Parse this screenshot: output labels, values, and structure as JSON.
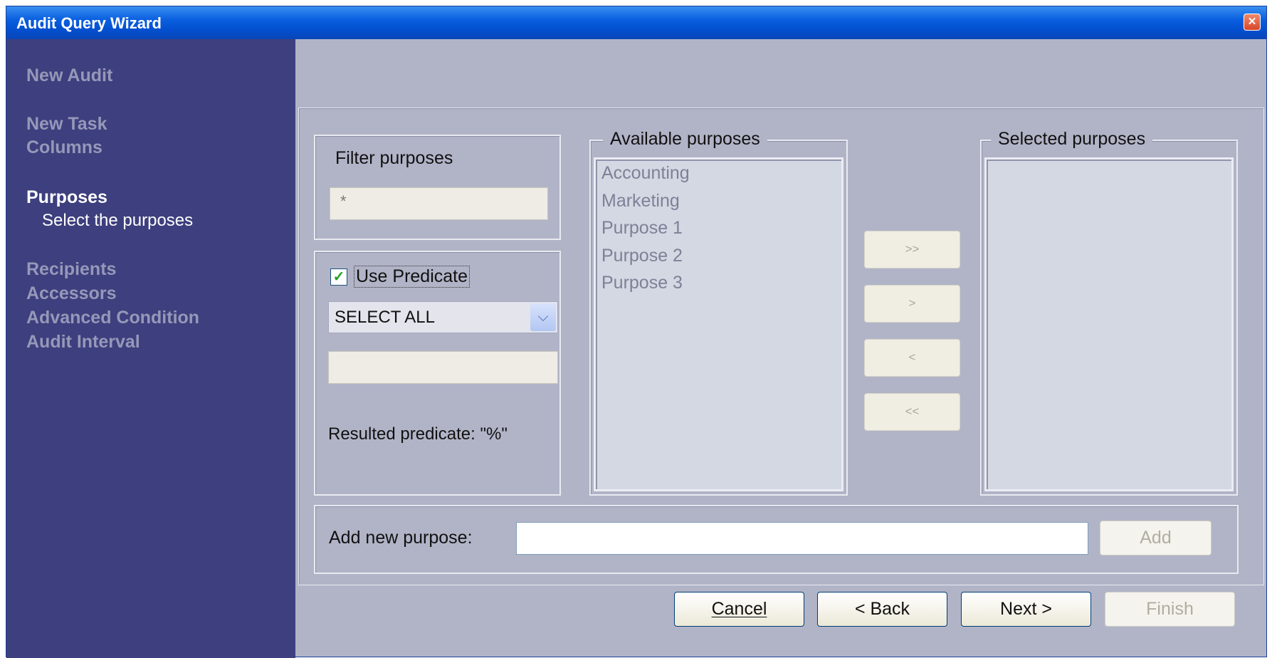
{
  "window": {
    "title": "Audit Query Wizard"
  },
  "sidebar": {
    "steps": [
      {
        "label": "New Audit"
      },
      {
        "label": "New Task"
      },
      {
        "label": "Columns"
      },
      {
        "label": "Purposes"
      },
      {
        "label": "Recipients"
      },
      {
        "label": "Accessors"
      },
      {
        "label": "Advanced Condition"
      },
      {
        "label": "Audit Interval"
      }
    ],
    "current_step_description": "Select the purposes"
  },
  "filter": {
    "title": "Filter purposes",
    "value": "*"
  },
  "predicate": {
    "checkbox_label": "Use Predicate",
    "checked": true,
    "combo_value": "SELECT ALL",
    "text_value": "",
    "result_text": "Resulted predicate: \"%\""
  },
  "available": {
    "title": "Available purposes",
    "items": [
      "Accounting",
      "Marketing",
      "Purpose 1",
      "Purpose 2",
      "Purpose 3"
    ]
  },
  "transfer": {
    "add_all": ">>",
    "add_one": ">",
    "remove_one": "<",
    "remove_all": "<<"
  },
  "selected": {
    "title": "Selected purposes",
    "items": []
  },
  "add_purpose": {
    "label": "Add new purpose:",
    "value": "",
    "button": "Add"
  },
  "footer": {
    "cancel": "Cancel",
    "back": "< Back",
    "next": "Next >",
    "finish": "Finish"
  },
  "colors": {
    "sidebar_bg": "#3d3f7e",
    "content_bg": "#b1b4c7",
    "titlebar": "#0a5fe0"
  }
}
